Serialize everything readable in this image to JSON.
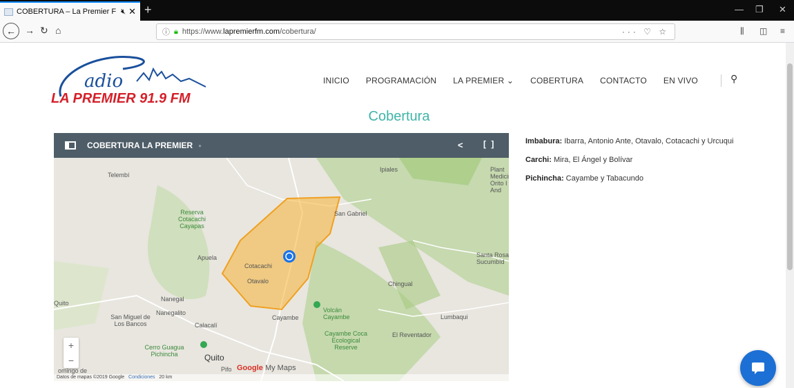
{
  "browser": {
    "tab_title": "COBERTURA – La Premier F",
    "tab_mute_icon": "muted-speaker-icon",
    "new_tab": "+",
    "url_prefix": "https://www.",
    "url_domain": "lapremierfm.com",
    "url_path": "/cobertura/",
    "url_right": "··· ♡ ☆"
  },
  "site": {
    "logo_script": "adio",
    "logo_text": "LA PREMIER 91.9 FM",
    "brand_color": "#d4202a",
    "accent_color": "#3fb4a7",
    "nav": [
      "INICIO",
      "PROGRAMACIÓN",
      "LA PREMIER ⌄",
      "COBERTURA",
      "CONTACTO",
      "EN VIVO"
    ],
    "page_title": "Cobertura"
  },
  "map": {
    "title": "COBERTURA LA PREMIER",
    "footer_data": "Datos de mapas ©2019 Google",
    "footer_terms": "Condiciones",
    "footer_scale": "20 km",
    "brand_google": "Google",
    "brand_mymaps": "My Maps",
    "coverage_color": "#f5b335",
    "labels": {
      "telembi": "Telembí",
      "ipiales": "Ipiales",
      "plant": "Plant Medicir Orito I And",
      "reserva": "Reserva Cotacachi Cayapas",
      "san_gabriel": "San Gabriel",
      "apuela": "Apuela",
      "cotacachi": "Cotacachi",
      "otavalo": "Otavalo",
      "santa_rosa": "Santa Rosa Sucumbíd",
      "chingual": "Chingual",
      "nanegal": "Nanegal",
      "quito_w": "Quito",
      "san_miguel": "San Miguel de Los Bancos",
      "nanegalito": "Nanegalito",
      "calacali": "Calacalí",
      "volcan": "Volcán Cayambe",
      "cayambe": "Cayambe",
      "lumbaqui": "Lumbaqui",
      "cayambe_coca": "Cayambe Coca Ecological Reserve",
      "reventador": "El Reventador",
      "cerro": "Cerro Guagua Pichincha",
      "quito": "Quito",
      "domingo": "omingo de",
      "pifo": "Pifo"
    },
    "zoom_in": "+",
    "zoom_out": "−"
  },
  "coverage": {
    "imbabura_label": "Imbabura:",
    "imbabura_text": " Ibarra, Antonio Ante,  Otavalo, Cotacachi y Urcuqui",
    "carchi_label": "Carchi:",
    "carchi_text": " Mira, El Ángel y Bolívar",
    "pichincha_label": "Pichincha:",
    "pichincha_text": " Cayambe y Tabacundo"
  }
}
